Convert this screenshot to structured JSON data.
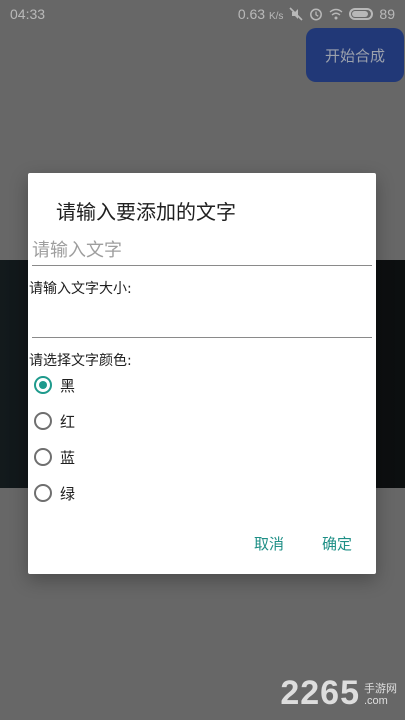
{
  "status_bar": {
    "time": "04:33",
    "network_speed": "0.63",
    "network_unit": "K/s",
    "battery": "89"
  },
  "start_button_label": "开始合成",
  "dialog": {
    "title": "请输入要添加的文字",
    "text_input_placeholder": "请输入文字",
    "size_label": "请输入文字大小:",
    "size_value": "",
    "color_label": "请选择文字颜色:",
    "color_options": [
      {
        "label": "黑",
        "selected": true
      },
      {
        "label": "红",
        "selected": false
      },
      {
        "label": "蓝",
        "selected": false
      },
      {
        "label": "绿",
        "selected": false
      }
    ],
    "cancel_label": "取消",
    "confirm_label": "确定"
  },
  "watermark": {
    "main": "2265",
    "side_top": "手游网",
    "side_bottom": ".com"
  },
  "colors": {
    "accent": "#1e9a8c",
    "start_button_bg": "#2f4ea6"
  },
  "icons": {
    "mute": "mute-icon",
    "alarm": "alarm-icon",
    "wifi": "wifi-icon",
    "battery": "battery-icon"
  }
}
